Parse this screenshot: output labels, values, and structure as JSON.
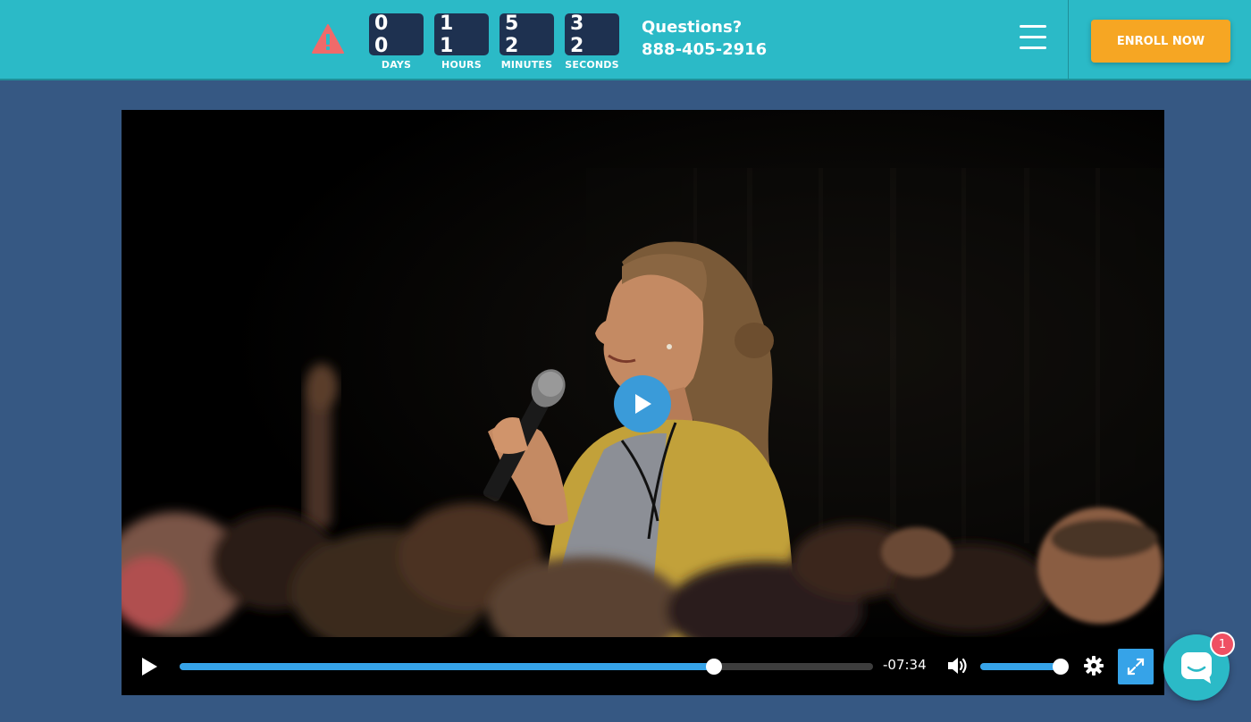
{
  "header": {
    "countdown": [
      {
        "value": "0 0",
        "label": "DAYS"
      },
      {
        "value": "1 1",
        "label": "HOURS"
      },
      {
        "value": "5 2",
        "label": "MINUTES"
      },
      {
        "value": "3 2",
        "label": "SECONDS"
      }
    ],
    "questions_label": "Questions?",
    "phone": "888-405-2916",
    "enroll_label": "ENROLL NOW",
    "warning_icon": "warning-triangle-icon",
    "menu_icon": "hamburger-menu-icon"
  },
  "player": {
    "time_remaining": "-07:34",
    "progress_fraction": 0.77,
    "volume_fraction": 1.0,
    "icons": {
      "big_play": "play-icon",
      "play": "play-icon",
      "volume": "volume-icon",
      "settings": "gear-icon",
      "fullscreen": "fullscreen-icon"
    }
  },
  "chat": {
    "badge_count": "1",
    "icon": "chat-icon"
  },
  "colors": {
    "page_background": "#365883",
    "header_background": "#2bbac7",
    "countdown_box": "#1e3150",
    "enroll_button": "#f6a623",
    "player_accent": "#36a3e8",
    "chat_badge": "#ef5063"
  }
}
